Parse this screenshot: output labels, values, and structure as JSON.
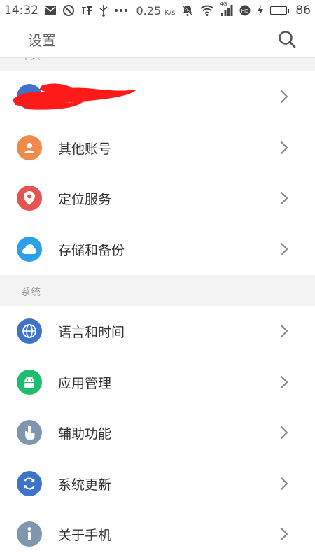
{
  "status_bar": {
    "time": "14:32",
    "speed_value": "0.25",
    "speed_unit": "K/s",
    "network_label": "4G",
    "battery_level": "86",
    "battery_fraction": 0.86,
    "left_icons": [
      "mail-icon",
      "blocked-icon",
      "taobao-icon",
      "usb-icon",
      "more-dots-icon"
    ],
    "right_icons": [
      "speed-indicator",
      "muted-bell-icon",
      "wifi-icon",
      "cellular-signal-icon",
      "hd-icon",
      "charging-icon",
      "battery-icon"
    ]
  },
  "header": {
    "title": "设置",
    "search_icon": "search-icon"
  },
  "sections": {
    "personal": {
      "title": "个人"
    },
    "system": {
      "title": "系统"
    }
  },
  "personal_items": [
    {
      "label": "",
      "icon": "redacted-profile",
      "note": "account entry redacted"
    },
    {
      "label": "其他账号",
      "icon": "person-icon",
      "color": "#f08a4b"
    },
    {
      "label": "定位服务",
      "icon": "location-pin-icon",
      "color": "#e8524f"
    },
    {
      "label": "存储和备份",
      "icon": "cloud-icon",
      "color": "#2aa0e8"
    }
  ],
  "system_items": [
    {
      "label": "语言和时间",
      "icon": "globe-icon",
      "color": "#3d73c9"
    },
    {
      "label": "应用管理",
      "icon": "android-icon",
      "color": "#1fbe6e"
    },
    {
      "label": "辅助功能",
      "icon": "hand-icon",
      "color": "#7e97ae"
    },
    {
      "label": "系统更新",
      "icon": "refresh-icon",
      "color": "#3d73c9"
    },
    {
      "label": "关于手机",
      "icon": "info-icon",
      "color": "#7e97ae"
    }
  ],
  "colors": {
    "redaction": "#ff1a1a",
    "chevron": "#8a8a8a",
    "section_bg": "#f3f3f3",
    "battery_fill": "#4caf50"
  }
}
